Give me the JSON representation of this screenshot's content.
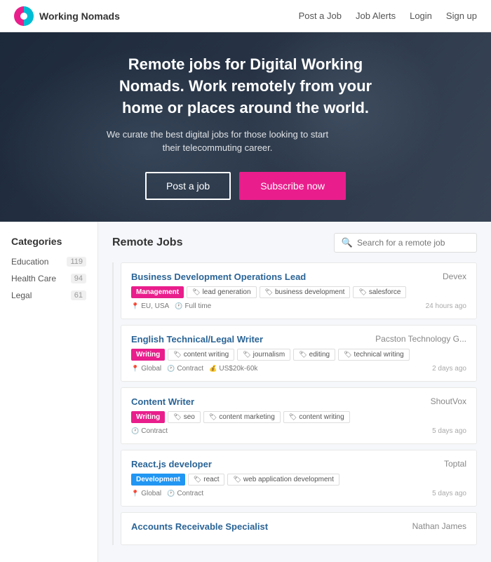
{
  "navbar": {
    "brand_name": "Working Nomads",
    "links": [
      {
        "label": "Post a Job",
        "id": "post-job"
      },
      {
        "label": "Job Alerts",
        "id": "job-alerts"
      },
      {
        "label": "Login",
        "id": "login"
      },
      {
        "label": "Sign up",
        "id": "signup"
      }
    ]
  },
  "hero": {
    "headline": "Remote jobs for Digital Working Nomads. Work remotely from your home or places around the world.",
    "subtext": "We curate the best digital jobs for those looking to start their telecommuting career.",
    "btn_post": "Post a job",
    "btn_subscribe": "Subscribe now"
  },
  "sidebar": {
    "title": "Categories",
    "items": [
      {
        "label": "Education",
        "count": "119"
      },
      {
        "label": "Health Care",
        "count": "94"
      },
      {
        "label": "Legal",
        "count": "61"
      }
    ]
  },
  "jobs": {
    "title": "Remote Jobs",
    "search_placeholder": "Search for a remote job",
    "listings": [
      {
        "title": "Business Development Operations Lead",
        "company": "Devex",
        "category": "Management",
        "category_type": "mgmt",
        "keywords": [
          "lead generation",
          "business development",
          "salesforce"
        ],
        "location": "EU, USA",
        "type": "Full time",
        "salary": "",
        "time": "24 hours ago"
      },
      {
        "title": "English Technical/Legal Writer",
        "company": "Pacston Technology G...",
        "category": "Writing",
        "category_type": "writing",
        "keywords": [
          "content writing",
          "journalism",
          "editing",
          "technical writing"
        ],
        "location": "Global",
        "type": "Contract",
        "salary": "US$20k-60k",
        "time": "2 days ago"
      },
      {
        "title": "Content Writer",
        "company": "ShoutVox",
        "category": "Writing",
        "category_type": "writing",
        "keywords": [
          "seo",
          "content marketing",
          "content writing"
        ],
        "location": "",
        "type": "Contract",
        "salary": "",
        "time": "5 days ago"
      },
      {
        "title": "React.js developer",
        "company": "Toptal",
        "category": "Development",
        "category_type": "dev",
        "keywords": [
          "react",
          "web application development"
        ],
        "location": "Global",
        "type": "Contract",
        "salary": "",
        "time": "5 days ago"
      },
      {
        "title": "Accounts Receivable Specialist",
        "company": "Nathan James",
        "category": "",
        "category_type": "",
        "keywords": [],
        "location": "",
        "type": "",
        "salary": "",
        "time": ""
      }
    ]
  }
}
